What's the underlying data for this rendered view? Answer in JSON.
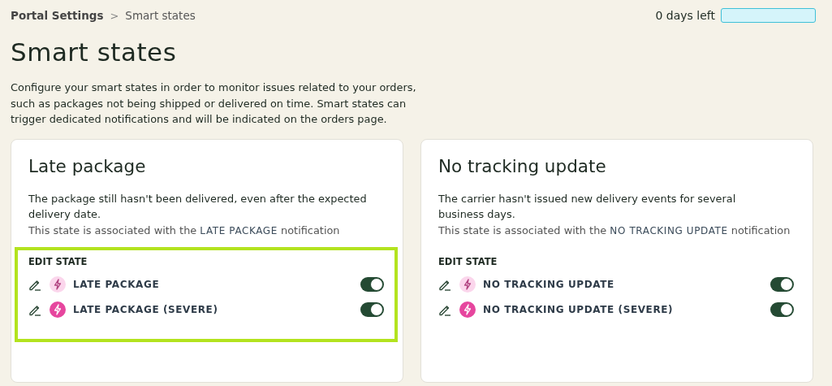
{
  "breadcrumb": {
    "parent": "Portal Settings",
    "separator": ">",
    "current": "Smart states"
  },
  "trial": {
    "label": "0 days left",
    "level": 0
  },
  "title": "Smart states",
  "description": "Configure your smart states in order to monitor issues related to your orders, such as packages not being shipped or delivered on time. Smart states can trigger dedicated notifications and will be indicated on the orders page.",
  "cards": [
    {
      "title": "Late package",
      "description": "The package still hasn't been delivered, even after the expected delivery date.",
      "association_prefix": "This state is associated with the",
      "notification": "LATE PACKAGE",
      "association_suffix": "notification",
      "edit_heading": "EDIT STATE",
      "highlighted": true,
      "states": [
        {
          "label": "LATE PACKAGE",
          "kind": "normal",
          "on": true
        },
        {
          "label": "LATE PACKAGE (SEVERE)",
          "kind": "severe",
          "on": true
        }
      ]
    },
    {
      "title": "No tracking update",
      "description": "The carrier hasn't issued new delivery events for several business days.",
      "association_prefix": "This state is associated with the",
      "notification": "NO TRACKING UPDATE",
      "association_suffix": "notification",
      "edit_heading": "EDIT STATE",
      "highlighted": false,
      "states": [
        {
          "label": "NO TRACKING UPDATE",
          "kind": "normal",
          "on": true
        },
        {
          "label": "NO TRACKING UPDATE (SEVERE)",
          "kind": "severe",
          "on": true
        }
      ]
    }
  ]
}
